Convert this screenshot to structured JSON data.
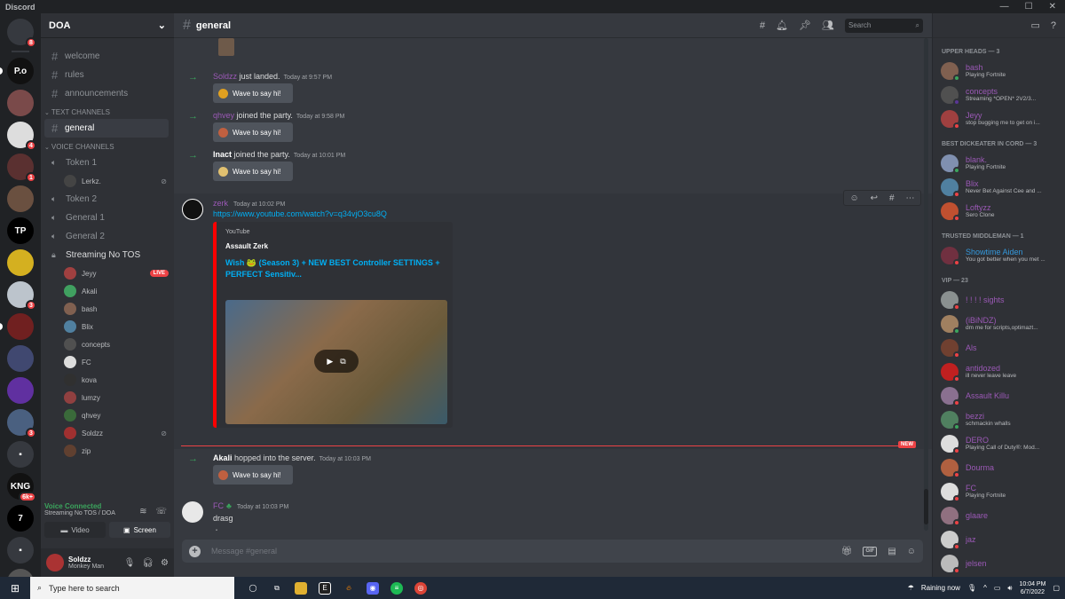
{
  "app": {
    "title": "Discord"
  },
  "guilds": [
    {
      "name": "discord-home",
      "color": "#36393f",
      "label": "",
      "badge": "8"
    },
    {
      "name": "server-pogs",
      "color": "#111",
      "label": "P.o",
      "badge": ""
    },
    {
      "name": "server-2",
      "color": "#7a4a4a",
      "label": "",
      "badge": ""
    },
    {
      "name": "server-3",
      "color": "#ddd",
      "label": "",
      "badge": "4"
    },
    {
      "name": "server-4",
      "color": "#5a3030",
      "label": "",
      "badge": "1"
    },
    {
      "name": "server-5",
      "color": "#6a5040",
      "label": "",
      "badge": ""
    },
    {
      "name": "server-tp",
      "color": "#000",
      "label": "TP",
      "badge": ""
    },
    {
      "name": "server-7",
      "color": "#d4b020",
      "label": "",
      "badge": ""
    },
    {
      "name": "server-8",
      "color": "#bcc4cc",
      "label": "",
      "badge": "3"
    },
    {
      "name": "server-9",
      "color": "#702020",
      "label": "",
      "badge": ""
    },
    {
      "name": "server-10",
      "color": "#404870",
      "label": "",
      "badge": ""
    },
    {
      "name": "server-11",
      "color": "#6030a0",
      "label": "",
      "badge": ""
    },
    {
      "name": "server-12",
      "color": "#4a6080",
      "label": "",
      "badge": "3"
    },
    {
      "name": "folder-1",
      "color": "#36393f",
      "label": "▪",
      "badge": ""
    },
    {
      "name": "server-kng",
      "color": "#111",
      "label": "KNG",
      "badge": "6k+"
    },
    {
      "name": "server-seven",
      "color": "#000",
      "label": "7",
      "badge": ""
    },
    {
      "name": "folder-2",
      "color": "#36393f",
      "label": "▪",
      "badge": ""
    },
    {
      "name": "server-18",
      "color": "#555",
      "label": "",
      "badge": ""
    }
  ],
  "server": {
    "name": "DOA",
    "channels_top": [
      "welcome",
      "rules",
      "announcements"
    ],
    "text_category": "TEXT CHANNELS",
    "text_channels": [
      "general"
    ],
    "voice_category": "VOICE CHANNELS",
    "token1": "Token 1",
    "token1_user": "Lerkz.",
    "voice_channels": [
      "Token 2",
      "General 1",
      "General 2"
    ],
    "streaming": "Streaming No TOS",
    "streaming_users": [
      {
        "name": "Jeyy",
        "color": "#a04040",
        "live": "LIVE"
      },
      {
        "name": "Akali",
        "color": "#40a060",
        "live": ""
      },
      {
        "name": "bash",
        "color": "#806050",
        "live": ""
      },
      {
        "name": "Blix",
        "color": "#5080a0",
        "live": ""
      },
      {
        "name": "concepts",
        "color": "#505050",
        "live": ""
      },
      {
        "name": "FC",
        "color": "#ddd",
        "live": ""
      },
      {
        "name": "kova",
        "color": "#303030",
        "live": ""
      },
      {
        "name": "lumzy",
        "color": "#904040",
        "live": ""
      },
      {
        "name": "qhvey",
        "color": "#3a6a3a",
        "live": ""
      },
      {
        "name": "Soldzz",
        "color": "#a03030",
        "live": ""
      },
      {
        "name": "zip",
        "color": "#604030",
        "live": ""
      }
    ]
  },
  "voice": {
    "status": "Voice Connected",
    "location": "Streaming No TOS / DOA",
    "video": "Video",
    "screen": "Screen"
  },
  "user": {
    "name": "Soldzz",
    "tag": "Monkey Man"
  },
  "channel": {
    "name": "general",
    "search_placeholder": "Search",
    "compose_placeholder": "Message #general"
  },
  "messages": {
    "join1": {
      "who": "Soldzz",
      "text": " just landed.",
      "ts": "Today at 9:57 PM",
      "color": "#9b59b6"
    },
    "join2": {
      "who": "qhvey",
      "text": " joined the party.",
      "ts": "Today at 9:58 PM",
      "color": "#9b59b6"
    },
    "join3": {
      "who": "Inact",
      "text": " joined the party.",
      "ts": "Today at 10:01 PM",
      "color": "#ffffff"
    },
    "wave": "Wave to say hi!",
    "zerk": {
      "author": "zerk",
      "ts": "Today at 10:02 PM",
      "link": "https://www.youtube.com/watch?v=q34vjO3cu8Q",
      "provider": "YouTube",
      "embed_author": "Assault Zerk",
      "embed_title": "Wish 🐸 (Season 3) + NEW BEST Controller SETTINGS + PERFECT Sensitiv..."
    },
    "new_label": "NEW",
    "join4": {
      "who": "Akali",
      "text": " hopped into the server.",
      "ts": "Today at 10:03 PM",
      "color": "#ffffff"
    },
    "fc": {
      "author": "FC",
      "ts": "Today at 10:03 PM",
      "lines": [
        "drasg",
        "drag"
      ]
    }
  },
  "members": {
    "groups": [
      {
        "title": "UPPER HEADS — 3",
        "items": [
          {
            "name": "bash",
            "status": "Playing Fortnite",
            "namecolor": "#9b59b6",
            "av": "#806050",
            "dot": "#3ba55d"
          },
          {
            "name": "concepts",
            "status": "Streaming *OPEN* 2V2/3...",
            "namecolor": "#9b59b6",
            "av": "#505050",
            "dot": "#593695"
          },
          {
            "name": "Jeyy",
            "status": "stop bugging me to get on i...",
            "namecolor": "#9b59b6",
            "av": "#a04040",
            "dot": "#ed4245"
          }
        ]
      },
      {
        "title": "BEST DICKEATER IN CORD — 3",
        "items": [
          {
            "name": "blank.",
            "status": "Playing Fortnite",
            "namecolor": "#9b59b6",
            "av": "#8090b0",
            "dot": "#3ba55d"
          },
          {
            "name": "Blix",
            "status": "Never Bet Against Cee and ...",
            "namecolor": "#9b59b6",
            "av": "#5080a0",
            "dot": "#ed4245"
          },
          {
            "name": "Loftyzz",
            "status": "Sero Clone",
            "namecolor": "#9b59b6",
            "av": "#c05030",
            "dot": "#ed4245"
          }
        ]
      },
      {
        "title": "TRUSTED MIDDLEMAN — 1",
        "items": [
          {
            "name": "Showtime Aiden",
            "status": "You got better when you met ...",
            "namecolor": "#3498db",
            "av": "#703040",
            "dot": "#ed4245"
          }
        ]
      },
      {
        "title": "VIP — 23",
        "items": [
          {
            "name": "! ! ! ! sights",
            "status": "",
            "namecolor": "#9b59b6",
            "av": "#8a9090",
            "dot": "#ed4245"
          },
          {
            "name": "(iBiNDZ)",
            "status": "dm me for scripts,optimazt...",
            "namecolor": "#9b59b6",
            "av": "#a08060",
            "dot": "#3ba55d"
          },
          {
            "name": "Als",
            "status": "",
            "namecolor": "#9b59b6",
            "av": "#704030",
            "dot": "#ed4245"
          },
          {
            "name": "antidozed",
            "status": "ill never leave leave",
            "namecolor": "#9b59b6",
            "av": "#c02020",
            "dot": "#ed4245"
          },
          {
            "name": "Assault Killu",
            "status": "",
            "namecolor": "#9b59b6",
            "av": "#8a7090",
            "dot": "#ed4245"
          },
          {
            "name": "bezzi",
            "status": "schmackin whalls",
            "namecolor": "#9b59b6",
            "av": "#508060",
            "dot": "#3ba55d"
          },
          {
            "name": "DERO",
            "status": "Playing Call of Duty®: Mod...",
            "namecolor": "#9b59b6",
            "av": "#ddd",
            "dot": "#ed4245"
          },
          {
            "name": "Dourma",
            "status": "",
            "namecolor": "#9b59b6",
            "av": "#b06040",
            "dot": "#ed4245"
          },
          {
            "name": "FC",
            "status": "Playing Fortnite",
            "namecolor": "#9b59b6",
            "av": "#ddd",
            "dot": "#ed4245"
          },
          {
            "name": "glaare",
            "status": "",
            "namecolor": "#9b59b6",
            "av": "#907080",
            "dot": "#ed4245"
          },
          {
            "name": "jaz",
            "status": "",
            "namecolor": "#9b59b6",
            "av": "#ccc",
            "dot": "#ed4245"
          },
          {
            "name": "jelsen",
            "status": "",
            "namecolor": "#9b59b6",
            "av": "#bbb",
            "dot": "#ed4245"
          }
        ]
      }
    ]
  },
  "taskbar": {
    "search_placeholder": "Type here to search",
    "weather": "Raining now",
    "time": "10:04 PM",
    "date": "6/7/2022"
  }
}
